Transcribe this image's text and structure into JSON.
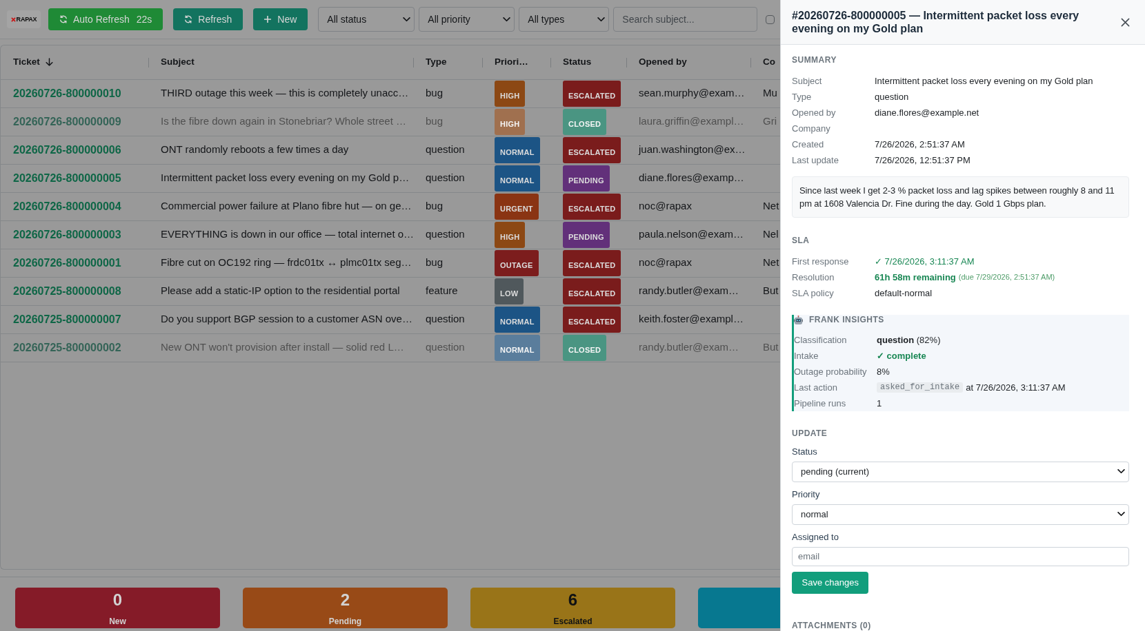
{
  "toolbar": {
    "logo": "RAPAX",
    "auto_refresh": {
      "label": "Auto Refresh",
      "countdown": "22s",
      "on": true
    },
    "refresh_label": "Refresh",
    "new_label": "New",
    "filters": [
      {
        "value": "All status"
      },
      {
        "value": "All priority"
      },
      {
        "value": "All types"
      }
    ],
    "search": {
      "placeholder": "Search subject..."
    },
    "checkbox": {
      "checked": false
    }
  },
  "table": {
    "columns": [
      {
        "label": "Ticket",
        "sorted": true
      },
      {
        "label": "Subject",
        "sorted": false
      },
      {
        "label": "Type",
        "sorted": false
      },
      {
        "label": "Priori…",
        "sorted": false
      },
      {
        "label": "Status",
        "sorted": false
      },
      {
        "label": "Opened by",
        "sorted": false
      },
      {
        "label": "Co"
      }
    ],
    "rows": [
      {
        "ticket": "20260726-800000010",
        "subject": "THIRD outage this week — this is completely unacc…",
        "type": "bug",
        "priority": {
          "label": "HIGH",
          "color": "#8c4814"
        },
        "status": {
          "label": "ESCALATED",
          "color": "#7a1c1c"
        },
        "opened_by": "sean.murphy@exam…",
        "company": "Mu",
        "muted": false
      },
      {
        "ticket": "20260726-800000009",
        "subject": "Is the fibre down again in Stonebriar? Whole street …",
        "type": "bug",
        "priority": {
          "label": "HIGH",
          "color": "#a0704f"
        },
        "status": {
          "label": "CLOSED",
          "color": "#4a9582"
        },
        "opened_by": "laura.griffin@exampl…",
        "company": "Gri",
        "muted": true
      },
      {
        "ticket": "20260726-800000006",
        "subject": "ONT randomly reboots a few times a day",
        "type": "question",
        "priority": {
          "label": "NORMAL",
          "color": "#1c5485"
        },
        "status": {
          "label": "ESCALATED",
          "color": "#7a1c1c"
        },
        "opened_by": "juan.washington@ex…",
        "muted": false
      },
      {
        "ticket": "20260726-800000005",
        "subject": "Intermittent packet loss every evening on my Gold p…",
        "type": "question",
        "priority": {
          "label": "NORMAL",
          "color": "#1c5485"
        },
        "status": {
          "label": "PENDING",
          "color": "#62307a"
        },
        "opened_by": "diane.flores@examp…",
        "muted": false
      },
      {
        "ticket": "20260726-800000004",
        "subject": "Commercial power failure at Plano fibre hut — on ge…",
        "type": "bug",
        "priority": {
          "label": "URGENT",
          "color": "#8a3413"
        },
        "status": {
          "label": "ESCALATED",
          "color": "#7a1c1c"
        },
        "opened_by": "noc@rapax",
        "company": "Net",
        "muted": false
      },
      {
        "ticket": "20260726-800000003",
        "subject": "EVERYTHING is down in our office — total internet o…",
        "type": "question",
        "priority": {
          "label": "HIGH",
          "color": "#8c4814"
        },
        "status": {
          "label": "PENDING",
          "color": "#62307a"
        },
        "opened_by": "paula.nelson@exam…",
        "company": "Nel",
        "muted": false
      },
      {
        "ticket": "20260726-800000001",
        "subject": "Fibre cut on OC192 ring — frdc01tx ↔ plmc01tx seg…",
        "type": "bug",
        "priority": {
          "label": "OUTAGE",
          "color": "#7c1d1d"
        },
        "status": {
          "label": "ESCALATED",
          "color": "#7a1c1c"
        },
        "opened_by": "noc@rapax",
        "company": "Net",
        "muted": false
      },
      {
        "ticket": "20260725-800000008",
        "subject": "Please add a static-IP option to the residential portal",
        "type": "feature",
        "priority": {
          "label": "LOW",
          "color": "#50585c"
        },
        "status": {
          "label": "ESCALATED",
          "color": "#7a1c1c"
        },
        "opened_by": "randy.butler@exam…",
        "company": "But",
        "muted": false
      },
      {
        "ticket": "20260725-800000007",
        "subject": "Do you support BGP session to a customer ASN ove…",
        "type": "question",
        "priority": {
          "label": "NORMAL",
          "color": "#1c5485"
        },
        "status": {
          "label": "ESCALATED",
          "color": "#7a1c1c"
        },
        "opened_by": "keith.foster@exampl…",
        "muted": false
      },
      {
        "ticket": "20260725-800000002",
        "subject": "New ONT won't provision after install — solid red L…",
        "type": "question",
        "priority": {
          "label": "NORMAL",
          "color": "#5a7d9c"
        },
        "status": {
          "label": "CLOSED",
          "color": "#4a9582"
        },
        "opened_by": "randy.butler@exam…",
        "company": "But",
        "muted": true
      }
    ]
  },
  "stat_cards": [
    {
      "count": "0",
      "label": "New",
      "color": "#851b28"
    },
    {
      "count": "2",
      "label": "Pending",
      "color": "#984a17"
    },
    {
      "count": "6",
      "label": "Escalated",
      "color": "#997418"
    },
    {
      "color": "#077890"
    }
  ],
  "detail_panel": {
    "title": "#20260726-800000005 — Intermittent packet loss every evening on my Gold plan",
    "summary": {
      "heading": "SUMMARY",
      "fields": [
        {
          "label": "Subject",
          "value": "Intermittent packet loss every evening on my Gold plan"
        },
        {
          "label": "Type",
          "value": "question"
        },
        {
          "label": "Opened by",
          "value": "diane.flores@example.net"
        },
        {
          "label": "Company"
        },
        {
          "label": "Created",
          "value": "7/26/2026, 2:51:37 AM"
        },
        {
          "label": "Last update",
          "value": "7/26/2026, 12:51:37 PM"
        }
      ],
      "description": "Since last week I get 2-3 % packet loss and lag spikes between roughly 8 and 11 pm at 1608 Valencia Dr. Fine during the day. Gold 1 Gbps plan."
    },
    "sla": {
      "heading": "SLA",
      "fields": [
        {
          "label": "First response",
          "value": "✓ 7/26/2026, 3:11:37 AM",
          "kind": "good"
        },
        {
          "label": "Resolution",
          "value": "61h 58m remaining",
          "note": "(due 7/29/2026, 2:51:37 AM)",
          "kind": "strong"
        },
        {
          "label": "SLA policy",
          "value": "default-normal",
          "kind": "plain"
        }
      ]
    },
    "insights": {
      "heading": "FRANK INSIGHTS",
      "fields": [
        {
          "label": "Classification",
          "value": "**question** (82%)",
          "kind": "plain"
        },
        {
          "label": "Intake",
          "value": "✓ complete",
          "kind": "strong"
        },
        {
          "label": "Outage probability",
          "value": "8%",
          "kind": "plain"
        },
        {
          "label": "Last action",
          "code": "asked_for_intake",
          "value": "at 7/26/2026, 3:11:37 AM",
          "kind": "code"
        },
        {
          "label": "Pipeline runs",
          "value": "1",
          "kind": "plain"
        }
      ]
    },
    "update": {
      "heading": "UPDATE",
      "fields": [
        {
          "label": "Status",
          "kind": "select",
          "value": "pending (current)"
        },
        {
          "label": "Priority",
          "kind": "select",
          "value": "normal"
        },
        {
          "label": "Assigned to",
          "kind": "input",
          "placeholder": "email"
        }
      ],
      "save_button": "Save changes"
    },
    "attachments": {
      "heading": "ATTACHMENTS (0)"
    }
  }
}
